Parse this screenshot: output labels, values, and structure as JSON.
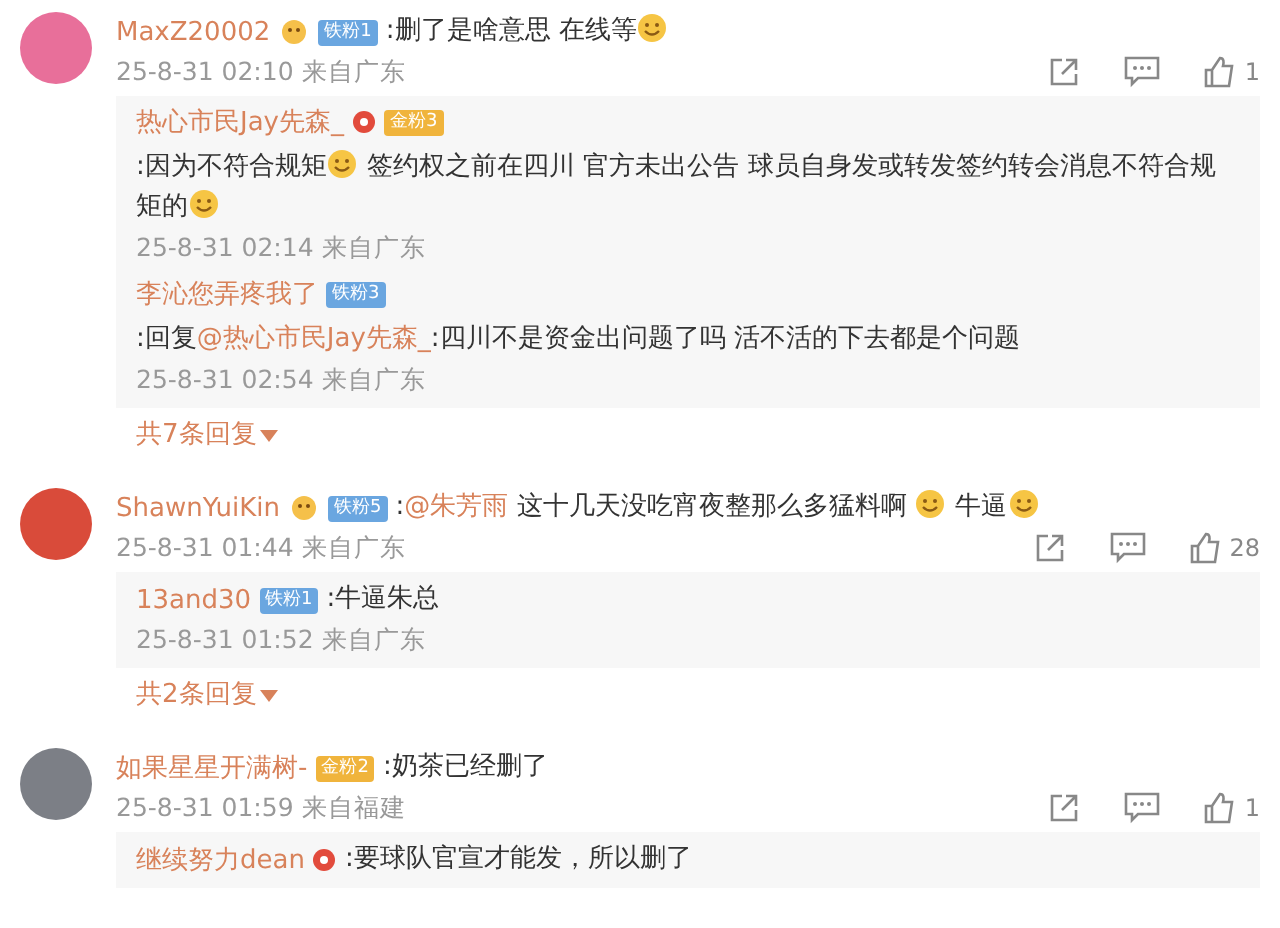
{
  "comments": [
    {
      "avatar": {
        "color": "#e86f9a"
      },
      "user": "MaxZ20002",
      "badges": [
        {
          "kind": "icon"
        },
        {
          "kind": "fan",
          "text": "铁粉1",
          "color": "#6aa6e0"
        }
      ],
      "content": [
        {
          "kind": "text",
          "text": ":删了是啥意思 在线等"
        },
        {
          "kind": "emoji"
        }
      ],
      "time": "25-8-31 02:10 来自广东",
      "likes": "1",
      "replies": [
        {
          "user": "热心市民Jay先森_",
          "badges": [
            {
              "kind": "verified"
            },
            {
              "kind": "fan",
              "text": "金粉3",
              "color": "#f0b43c"
            }
          ],
          "content": [
            {
              "kind": "text",
              "text": ":因为不符合规矩"
            },
            {
              "kind": "emoji"
            },
            {
              "kind": "text",
              "text": " 签约权之前在四川 官方未出公告 球员自身发或转发签约转会消息不符合规矩的"
            },
            {
              "kind": "emoji"
            }
          ],
          "time": "25-8-31 02:14 来自广东"
        },
        {
          "user": "李沁您弄疼我了",
          "badges": [
            {
              "kind": "fan",
              "text": "铁粉3",
              "color": "#6aa6e0"
            }
          ],
          "content": [
            {
              "kind": "text",
              "text": ":回复"
            },
            {
              "kind": "mention",
              "text": "@热心市民Jay先森_"
            },
            {
              "kind": "text",
              "text": ":四川不是资金出问题了吗 活不活的下去都是个问题"
            }
          ],
          "time": "25-8-31 02:54 来自广东"
        }
      ],
      "more": "共7条回复"
    },
    {
      "avatar": {
        "color": "#d94b3a"
      },
      "user": "ShawnYuiKin",
      "badges": [
        {
          "kind": "icon"
        },
        {
          "kind": "fan",
          "text": "铁粉5",
          "color": "#6aa6e0"
        }
      ],
      "content": [
        {
          "kind": "text",
          "text": ":"
        },
        {
          "kind": "mention",
          "text": "@朱芳雨"
        },
        {
          "kind": "text",
          "text": " 这十几天没吃宵夜整那么多猛料啊 "
        },
        {
          "kind": "emoji"
        },
        {
          "kind": "text",
          "text": " 牛逼"
        },
        {
          "kind": "emoji"
        }
      ],
      "time": "25-8-31 01:44 来自广东",
      "likes": "28",
      "replies": [
        {
          "user": "13and30",
          "badges": [
            {
              "kind": "fan",
              "text": "铁粉1",
              "color": "#6aa6e0"
            }
          ],
          "content": [
            {
              "kind": "text",
              "text": ":牛逼朱总"
            }
          ],
          "time": "25-8-31 01:52 来自广东"
        }
      ],
      "more": "共2条回复"
    },
    {
      "avatar": {
        "color": "#7c7f86"
      },
      "user": "如果星星开满树-",
      "badges": [
        {
          "kind": "fan",
          "text": "金粉2",
          "color": "#f0b43c"
        }
      ],
      "content": [
        {
          "kind": "text",
          "text": ":奶茶已经删了"
        }
      ],
      "time": "25-8-31 01:59 来自福建",
      "likes": "1",
      "replies": [
        {
          "user": "继续努力dean",
          "badges": [
            {
              "kind": "verified"
            }
          ],
          "content": [
            {
              "kind": "text",
              "text": ":要球队官宣才能发，所以删了"
            }
          ]
        }
      ]
    }
  ]
}
